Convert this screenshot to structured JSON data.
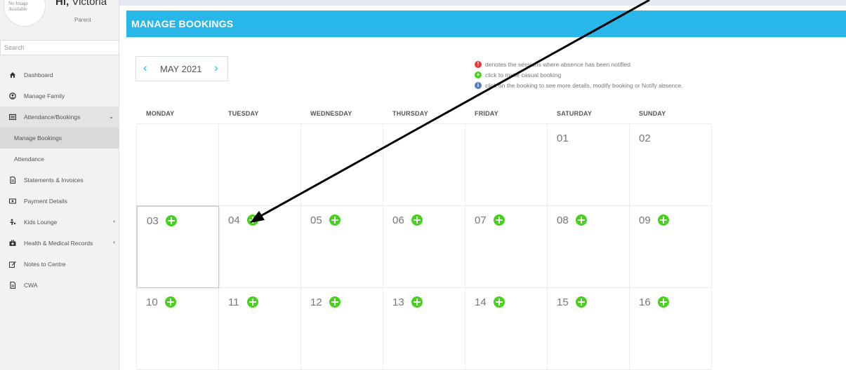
{
  "sidebar": {
    "avatar_text": "No Image Available",
    "greeting_hi": "Hi,",
    "greeting_name": "Victoria",
    "role": "Parent",
    "search_placeholder": "Search",
    "items": [
      {
        "label": "Dashboard",
        "icon": "home-icon"
      },
      {
        "label": "Manage Family",
        "icon": "user-icon"
      },
      {
        "label": "Attendance/Bookings",
        "icon": "list-icon"
      },
      {
        "label": "Manage Bookings",
        "icon": ""
      },
      {
        "label": "Attendance",
        "icon": ""
      },
      {
        "label": "Statements & Invoices",
        "icon": "document-icon"
      },
      {
        "label": "Payment Details",
        "icon": "money-icon"
      },
      {
        "label": "Kids Lounge",
        "icon": "child-icon"
      },
      {
        "label": "Health & Medical Records",
        "icon": "medkit-icon"
      },
      {
        "label": "Notes to Centre",
        "icon": "edit-icon"
      },
      {
        "label": "CWA",
        "icon": "document-icon"
      }
    ]
  },
  "header": {
    "title": "MANAGE BOOKINGS"
  },
  "month": {
    "label": "MAY 2021",
    "prev": "‹",
    "next": "›"
  },
  "legend": [
    {
      "symbol": "!",
      "color": "#e53935",
      "text": "denotes the sessions where absence has been notified"
    },
    {
      "symbol": "+",
      "color": "#46d11c",
      "text": "click to make casual booking"
    },
    {
      "symbol": "i",
      "color": "#4f7fbf",
      "text": "click on the booking to see more details, modify booking or Notify absence."
    }
  ],
  "calendar": {
    "weekdays": [
      "MONDAY",
      "TUESDAY",
      "WEDNESDAY",
      "THURSDAY",
      "FRIDAY",
      "SATURDAY",
      "SUNDAY"
    ],
    "days": [
      {
        "day": "",
        "add": false
      },
      {
        "day": "",
        "add": false
      },
      {
        "day": "",
        "add": false
      },
      {
        "day": "",
        "add": false
      },
      {
        "day": "",
        "add": false
      },
      {
        "day": "01",
        "add": false
      },
      {
        "day": "02",
        "add": false
      },
      {
        "day": "03",
        "add": true
      },
      {
        "day": "04",
        "add": true
      },
      {
        "day": "05",
        "add": true
      },
      {
        "day": "06",
        "add": true
      },
      {
        "day": "07",
        "add": true
      },
      {
        "day": "08",
        "add": true
      },
      {
        "day": "09",
        "add": true
      },
      {
        "day": "10",
        "add": true
      },
      {
        "day": "11",
        "add": true
      },
      {
        "day": "12",
        "add": true
      },
      {
        "day": "13",
        "add": true
      },
      {
        "day": "14",
        "add": true
      },
      {
        "day": "15",
        "add": true
      },
      {
        "day": "16",
        "add": true
      }
    ]
  },
  "colors": {
    "accent": "#29b6e8",
    "add": "#46d11c"
  }
}
